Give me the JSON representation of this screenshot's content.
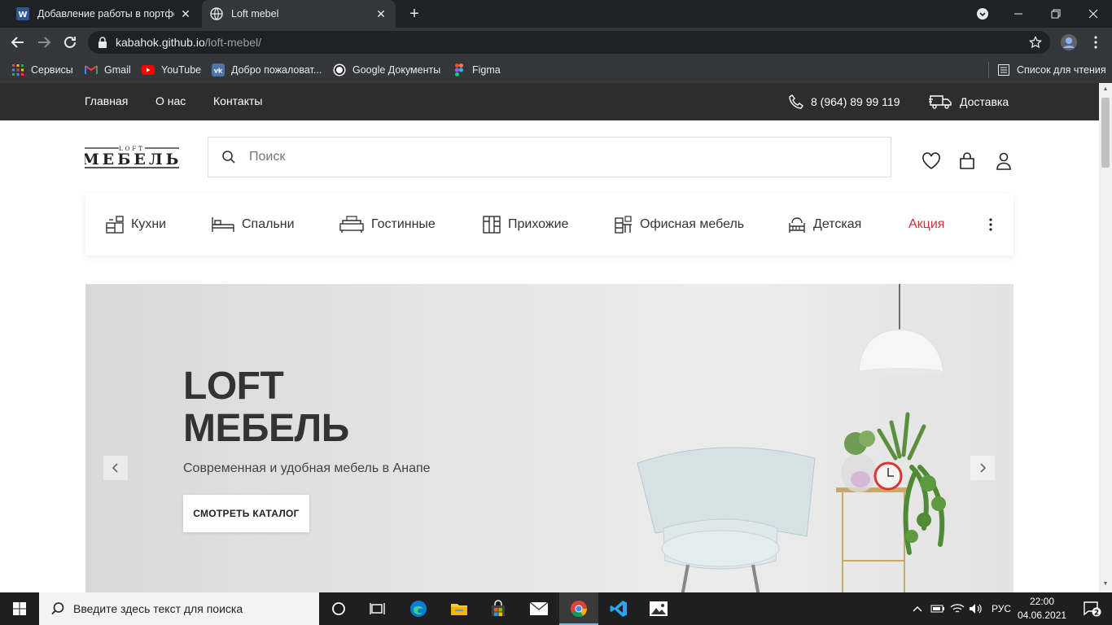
{
  "browser": {
    "tabs": [
      {
        "title": "Добавление работы в портфолио",
        "favicon": "word-icon"
      },
      {
        "title": "Loft mebel",
        "favicon": "globe-icon"
      }
    ],
    "url_host": "kabahok.github.io",
    "url_path": "/loft-mebel/",
    "bookmarks": [
      {
        "label": "Сервисы",
        "icon": "apps-grid-icon"
      },
      {
        "label": "Gmail",
        "icon": "gmail-icon"
      },
      {
        "label": "YouTube",
        "icon": "youtube-icon"
      },
      {
        "label": "Добро пожаловат...",
        "icon": "vk-icon"
      },
      {
        "label": "Google Документы",
        "icon": "google-docs-icon"
      },
      {
        "label": "Figma",
        "icon": "figma-icon"
      }
    ],
    "reading_list": "Список для чтения"
  },
  "site": {
    "topnav": [
      "Главная",
      "О нас",
      "Контакты"
    ],
    "phone": "8 (964) 89 99 119",
    "delivery": "Доставка",
    "logo_small": "LOFT",
    "logo_big": "МЕБЕЛЬ",
    "search_placeholder": "Поиск",
    "categories": [
      {
        "label": "Кухни",
        "icon": "kitchen-icon"
      },
      {
        "label": "Спальни",
        "icon": "bed-icon"
      },
      {
        "label": "Гостинные",
        "icon": "sofa-icon"
      },
      {
        "label": "Прихожие",
        "icon": "wardrobe-icon"
      },
      {
        "label": "Офисная мебель",
        "icon": "office-icon"
      },
      {
        "label": "Детская",
        "icon": "kids-icon"
      },
      {
        "label": "Акция",
        "icon": ""
      }
    ],
    "hero": {
      "title_line1": "LOFT",
      "title_line2": "МЕБЕЛЬ",
      "subtitle": "Современная и удобная мебель в Анапе",
      "cta": "СМОТРЕТЬ КАТАЛОГ"
    }
  },
  "taskbar": {
    "search_placeholder": "Введите здесь текст для поиска",
    "lang": "РУС",
    "time": "22:00",
    "date": "04.06.2021",
    "notifications": "2"
  },
  "colors": {
    "topbar": "#2d2d2d",
    "sale": "#c9353b",
    "tab_active": "#35363a",
    "tab_strip": "#202124"
  }
}
